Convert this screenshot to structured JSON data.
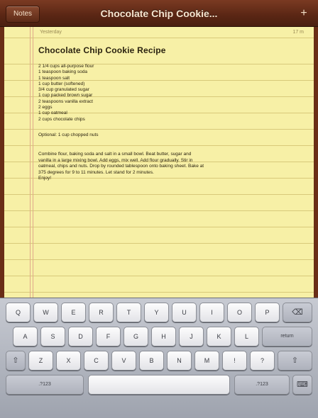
{
  "toolbar": {
    "back_label": "Notes",
    "title": "Chocolate Chip Cookie...",
    "add_icon": "plus-icon"
  },
  "note": {
    "date": "Yesterday",
    "time": "17 m",
    "heading": "Chocolate Chip Cookie Recipe",
    "ingredients": [
      "2 1/4 cups all-purpose flour",
      "1 teaspoon baking soda",
      "1 teaspoon salt",
      "1 cup butter (softened)",
      "3/4 cup granulated sugar",
      "1 cup packed brown sugar",
      "2 teaspoons vanilla extract",
      "2 eggs",
      "1 cup oatmeal",
      "2 cups chocolate chips"
    ],
    "optional": "Optional: 1 cup chopped nuts",
    "instructions": [
      "Combine flour, baking soda and salt in a small bowl. Beat butter, sugar and",
      "vanilla in a large mixing bowl. Add eggs, mix well. Add flour gradually. Stir in",
      "oatmeal, chips and nuts. Drop by rounded tablespoon onto baking sheet. Bake at",
      "375 degrees for 9 to 11 minutes. Let stand for 2 minutes.",
      "Enjoy!"
    ]
  },
  "keyboard": {
    "row1": [
      "Q",
      "W",
      "E",
      "R",
      "T",
      "Y",
      "U",
      "I",
      "O",
      "P"
    ],
    "row2": [
      "A",
      "S",
      "D",
      "F",
      "G",
      "H",
      "J",
      "K",
      "L"
    ],
    "row3": [
      "Z",
      "X",
      "C",
      "V",
      "B",
      "N",
      "M",
      "!",
      "?"
    ],
    "return_label": "return",
    "numbers_label": ".?123",
    "shift_icon": "shift-arrow-icon",
    "backspace_icon": "backspace-icon",
    "hide_icon": "keyboard-hide-icon"
  }
}
